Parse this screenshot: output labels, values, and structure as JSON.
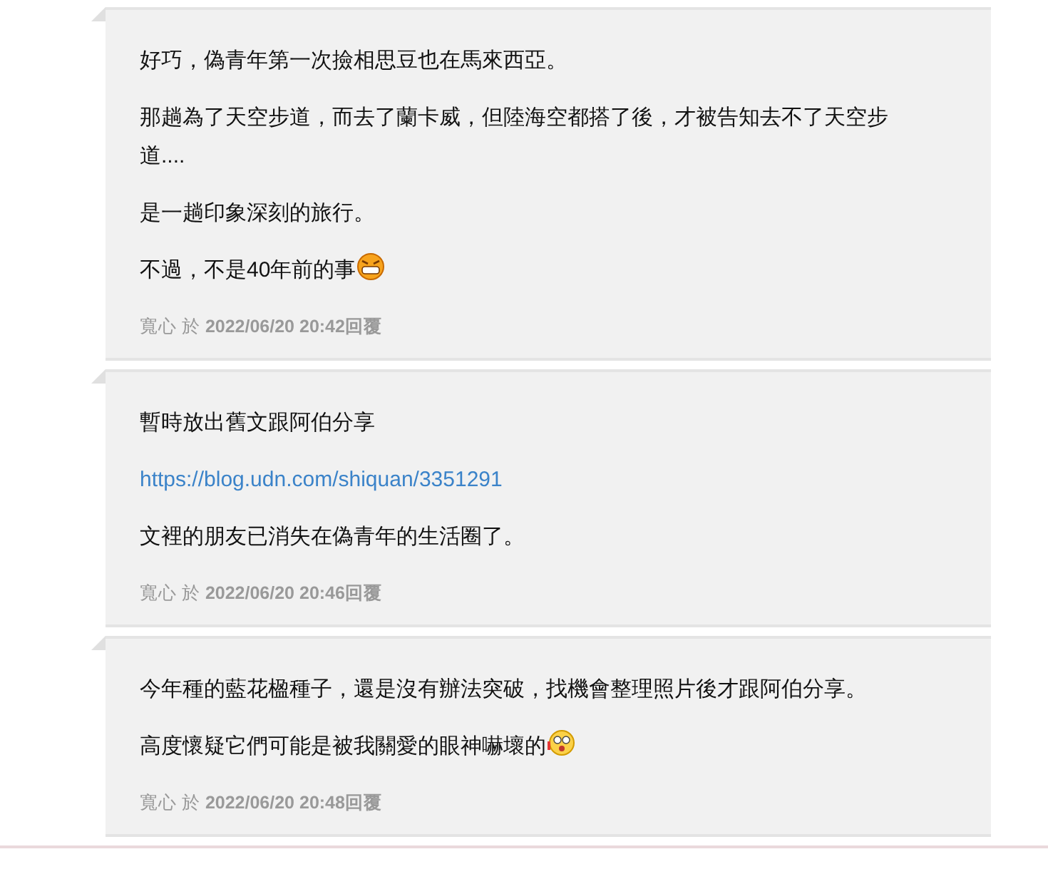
{
  "comments": [
    {
      "paragraphs": [
        {
          "kind": "text",
          "text": "好巧，偽青年第一次撿相思豆也在馬來西亞。"
        },
        {
          "kind": "text",
          "text": "那趟為了天空步道，而去了蘭卡威，但陸海空都搭了後，才被告知去不了天空步道...."
        },
        {
          "kind": "text",
          "text": "是一趟印象深刻的旅行。"
        },
        {
          "kind": "grin",
          "text": "不過，不是40年前的事"
        }
      ],
      "footer": "寬心 於 **2022/06/20 20:42回覆**"
    },
    {
      "paragraphs": [
        {
          "kind": "text",
          "text": "暫時放出舊文跟阿伯分享"
        },
        {
          "kind": "link",
          "text": "https://blog.udn.com/shiquan/3351291"
        },
        {
          "kind": "text",
          "text": "文裡的朋友已消失在偽青年的生活圈了。"
        }
      ],
      "footer": "寬心 於 **2022/06/20 20:46回覆**"
    },
    {
      "paragraphs": [
        {
          "kind": "text",
          "text": "今年種的藍花楹種子，還是沒有辦法突破，找機會整理照片後才跟阿伯分享。"
        },
        {
          "kind": "shock",
          "text": "高度懷疑它們可能是被我關愛的眼神嚇壞的"
        }
      ],
      "footer": "寬心 於 **2022/06/20 20:48回覆**"
    }
  ]
}
